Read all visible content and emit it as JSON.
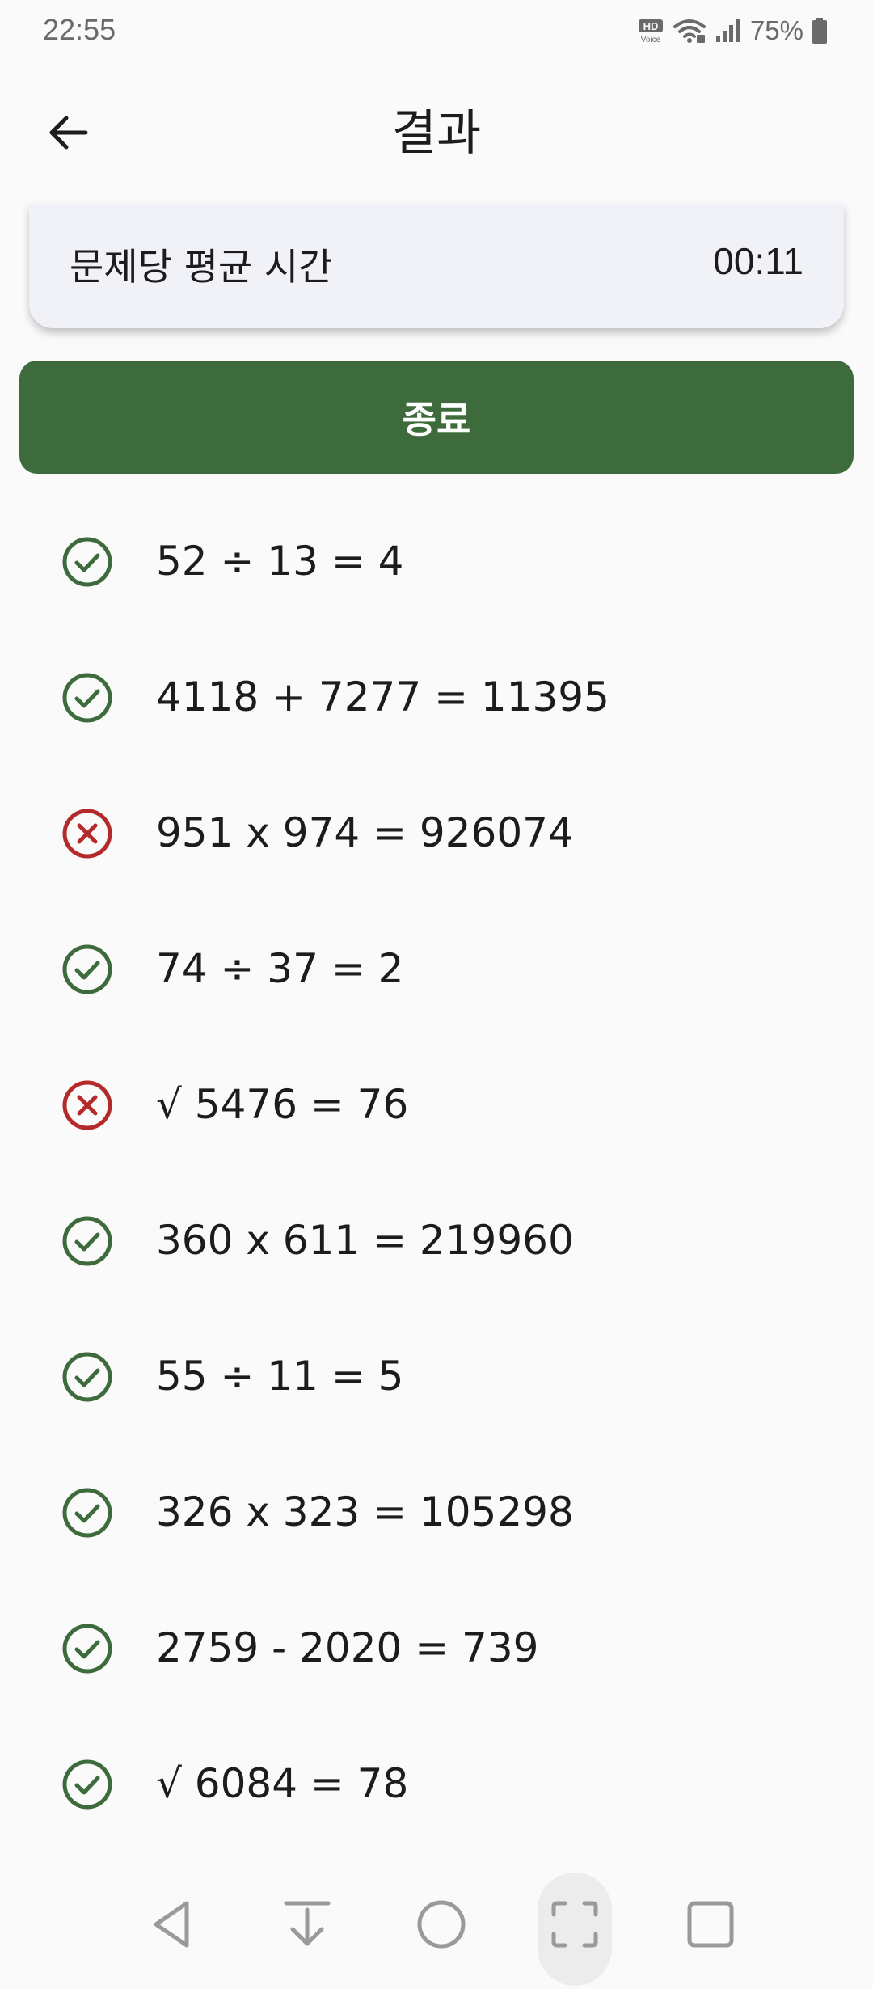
{
  "status_bar": {
    "time": "22:55",
    "battery_percent": "75%",
    "hd_voice_label": "HD",
    "hd_voice_sub": "Voice",
    "icons": [
      "hd-voice-icon",
      "wifi-icon",
      "signal-icon",
      "battery-icon"
    ]
  },
  "app_bar": {
    "title": "결과",
    "back_icon": "arrow-left-icon"
  },
  "stats": {
    "label": "문제당 평균 시간",
    "value": "00:11"
  },
  "finish_button": {
    "label": "종료",
    "color": "#3d6b3c"
  },
  "colors": {
    "correct": "#3d6b3c",
    "incorrect": "#b42a2a"
  },
  "results": [
    {
      "expression": "52 ÷ 13 = 4",
      "status": "correct"
    },
    {
      "expression": "4118 + 7277 = 11395",
      "status": "correct"
    },
    {
      "expression": "951 x 974 = 926074",
      "status": "incorrect"
    },
    {
      "expression": "74 ÷ 37 = 2",
      "status": "correct"
    },
    {
      "expression": "√ 5476 = 76",
      "status": "incorrect"
    },
    {
      "expression": "360 x 611 = 219960",
      "status": "correct"
    },
    {
      "expression": "55 ÷ 11 = 5",
      "status": "correct"
    },
    {
      "expression": "326 x 323 = 105298",
      "status": "correct"
    },
    {
      "expression": "2759 - 2020 = 739",
      "status": "correct"
    },
    {
      "expression": "√ 6084 = 78",
      "status": "correct"
    }
  ],
  "nav_bar": {
    "buttons": [
      "back-triangle-icon",
      "download-icon",
      "home-circle-icon",
      "screenshot-frame-icon",
      "recents-square-icon"
    ]
  }
}
